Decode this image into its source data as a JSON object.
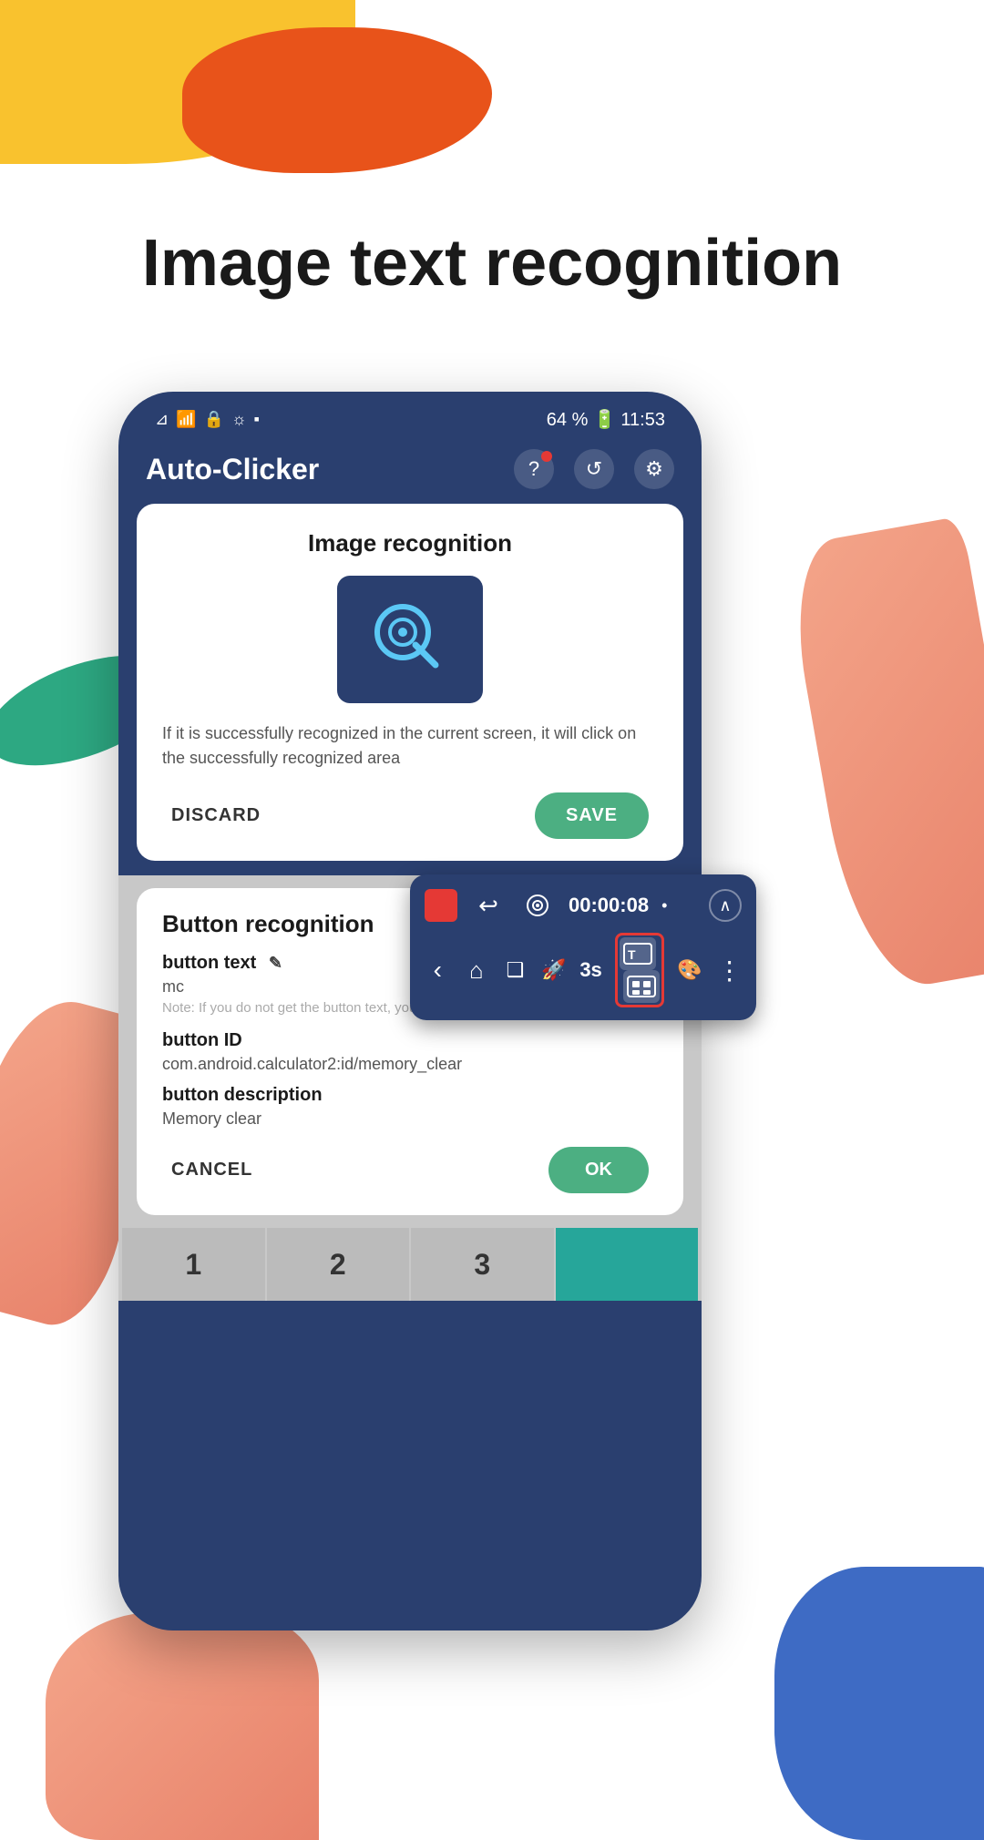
{
  "page": {
    "headline": "Image text recognition",
    "background": "#ffffff"
  },
  "decorative": {
    "blob_yellow_color": "#F9C22E",
    "blob_orange_color": "#E8531A",
    "blob_green_color": "#2DA882"
  },
  "phone": {
    "status_bar": {
      "signal": "⊿ull",
      "wifi": "WiFi",
      "battery_percent": "64 %",
      "battery_icon": "🔋",
      "time": "11:53"
    },
    "app_bar": {
      "title": "Auto-Clicker",
      "help_icon": "?",
      "history_icon": "↺",
      "settings_icon": "⚙"
    },
    "image_recognition_card": {
      "title": "Image recognition",
      "description": "If it is successfully recognized in the current screen, it will click on the successfully recognized area",
      "discard_label": "DISCARD",
      "save_label": "SAVE"
    },
    "floating_toolbar": {
      "stop_icon": "■",
      "undo_icon": "↩",
      "target_icon": "◎",
      "timer": "00:00:08",
      "expand_icon": "∧",
      "back_icon": "‹",
      "home_icon": "⌂",
      "menu_icon": "❑",
      "rocket_icon": "🚀",
      "countdown": "3s",
      "text_recog_icon": "T",
      "image_recog_icon": "⊞",
      "palette_icon": "🎨",
      "more_icon": "⋮"
    },
    "button_recognition_card": {
      "title": "Button recognition",
      "button_text_label": "button text",
      "button_text_value": "mc",
      "button_text_note": "Note: If you do not get the button text, you can manually enter it",
      "button_id_label": "button ID",
      "button_id_value": "com.android.calculator2:id/memory_clear",
      "button_description_label": "button description",
      "button_description_value": "Memory clear",
      "cancel_label": "CANCEL",
      "ok_label": "OK"
    },
    "calculator": {
      "keys": [
        "1",
        "2",
        "3",
        ""
      ],
      "key_colors": [
        "gray",
        "gray",
        "gray",
        "teal"
      ]
    }
  }
}
